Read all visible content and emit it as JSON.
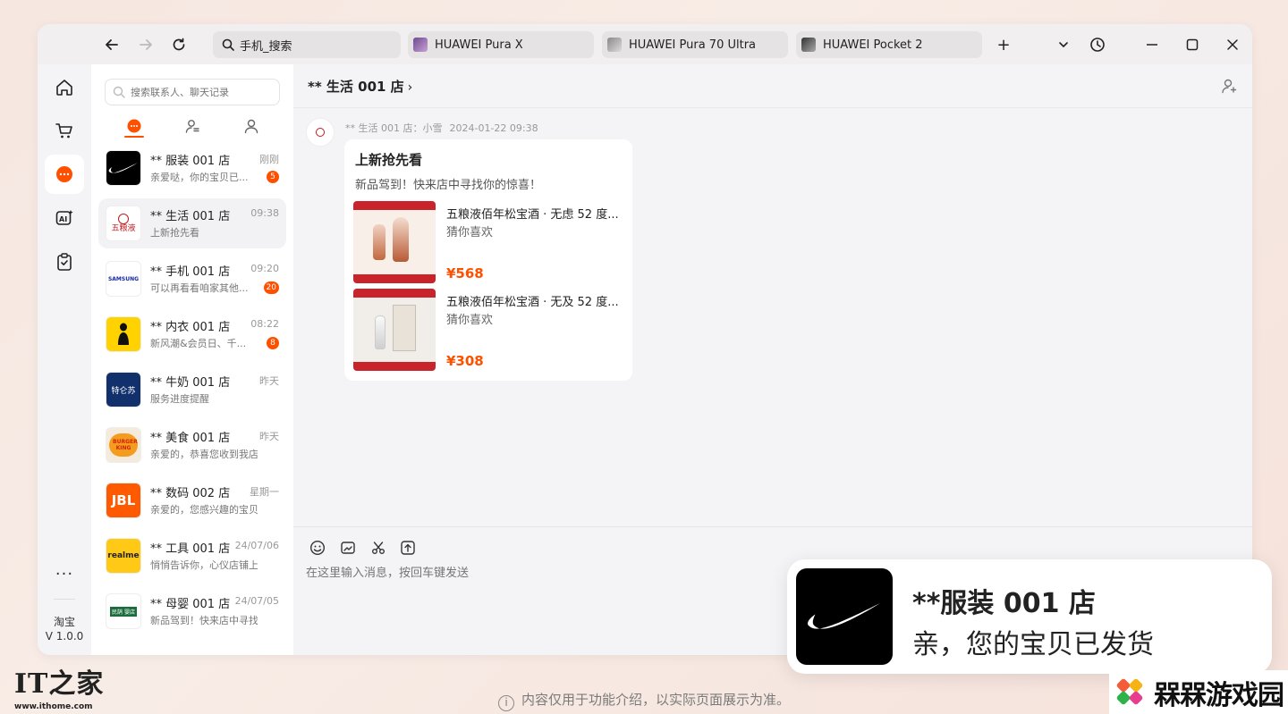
{
  "topbar": {
    "search_text": "手机_搜索",
    "tabs": [
      {
        "label": "HUAWEI Pura X"
      },
      {
        "label": "HUAWEI Pura 70 Ultra"
      },
      {
        "label": "HUAWEI Pocket 2"
      }
    ],
    "new_tab": "+"
  },
  "rail": {
    "more": "···",
    "app_name": "淘宝",
    "version": "V 1.0.0"
  },
  "list": {
    "search_placeholder": "搜索联系人、聊天记录",
    "contacts": [
      {
        "name": "** 服装 001 店",
        "time": "刚刚",
        "preview": "亲爱哒，你的宝贝已...",
        "badge": "5",
        "logo": "NIKE"
      },
      {
        "name": "** 生活 001 店",
        "time": "09:38",
        "preview": "上新抢先看",
        "badge": "",
        "logo": "五粮液"
      },
      {
        "name": "** 手机 001 店",
        "time": "09:20",
        "preview": "可以再看看咱家其他...",
        "badge": "20",
        "logo": "SAMSUNG"
      },
      {
        "name": "** 内衣 001 店",
        "time": "08:22",
        "preview": "新风潮&会员日、千...",
        "badge": "8",
        "logo": ""
      },
      {
        "name": "** 牛奶 001 店",
        "time": "昨天",
        "preview": "服务进度提醒",
        "badge": "",
        "logo": "特仑苏"
      },
      {
        "name": "** 美食 001 店",
        "time": "昨天",
        "preview": "亲爱的，恭喜您收到我店...",
        "badge": "",
        "logo": "BURGER KING"
      },
      {
        "name": "** 数码 002 店",
        "time": "星期一",
        "preview": "亲爱的，您感兴趣的宝贝...",
        "badge": "",
        "logo": "JBL"
      },
      {
        "name": "** 工具 001 店",
        "time": "24/07/06",
        "preview": "悄悄告诉你，心仪店铺上...",
        "badge": "",
        "logo": "realme"
      },
      {
        "name": "** 母婴 001 店",
        "time": "24/07/05",
        "preview": "新品驾到！快来店中寻找...",
        "badge": "",
        "logo": "民鹄 婴店"
      }
    ]
  },
  "chat": {
    "title": "** 生活 001 店",
    "chevron": "›",
    "message": {
      "sender": "** 生活 001 店：小雪",
      "timestamp": "2024-01-22 09:38",
      "card_title": "上新抢先看",
      "card_subtitle": "新品驾到！快来店中寻找你的惊喜！",
      "products": [
        {
          "name": "五粮液佰年松宝酒 · 无虑 52 度...",
          "tag": "猜你喜欢",
          "price": "¥568"
        },
        {
          "name": "五粮液佰年松宝酒 · 无及 52 度...",
          "tag": "猜你喜欢",
          "price": "¥308"
        }
      ]
    },
    "input_placeholder": "在这里输入消息，按回车键发送"
  },
  "toast": {
    "title": "**服装 001 店",
    "body": "亲，您的宝贝已发货"
  },
  "watermark": {
    "mark": "IT之家",
    "url": "www.ithome.com"
  },
  "footer": {
    "note": "内容仅用于功能介绍，以实际页面展示为准。"
  },
  "gamelogo": {
    "text": "槑槑游戏园"
  },
  "colors": {
    "accent": "#ff5000"
  }
}
